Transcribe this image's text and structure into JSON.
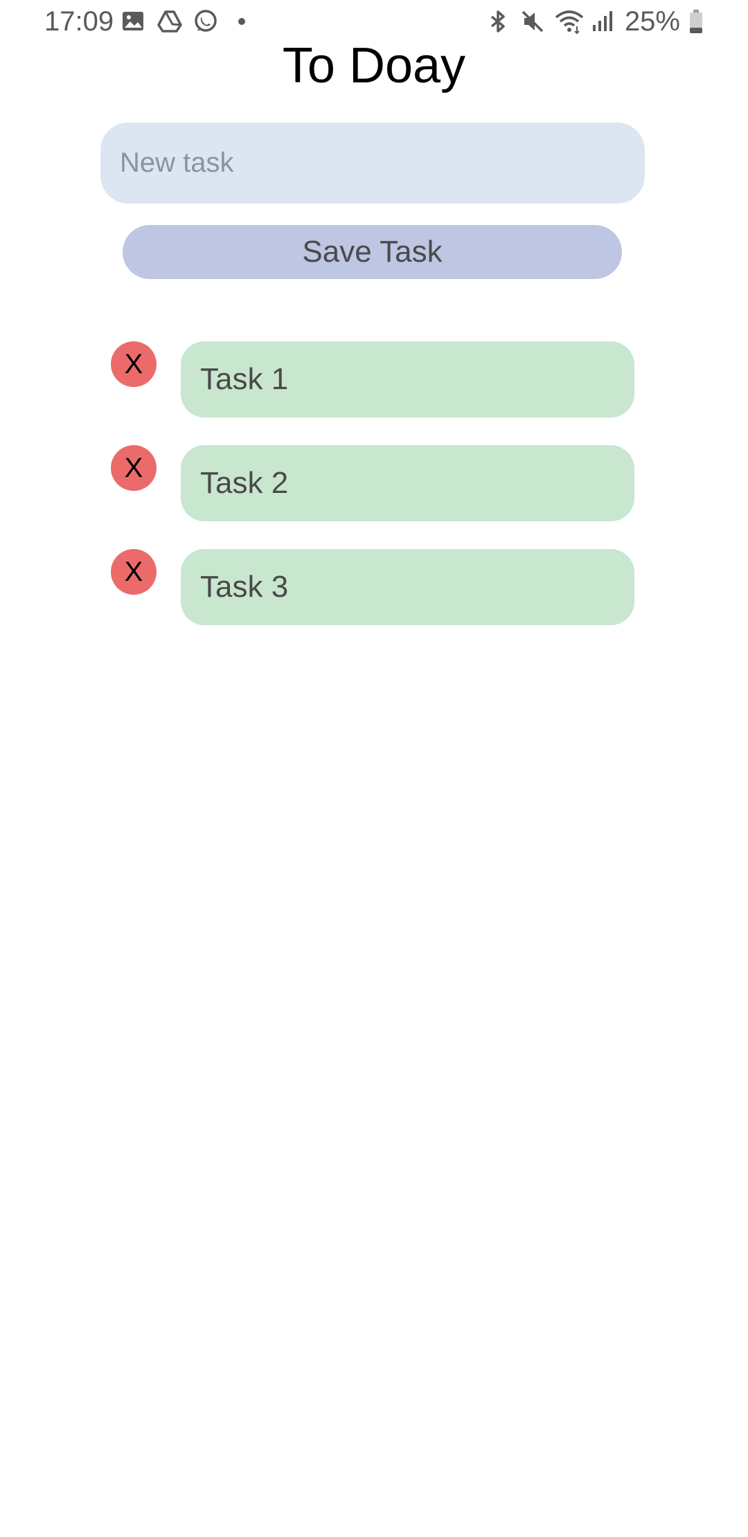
{
  "status_bar": {
    "time": "17:09",
    "left_icons": [
      "image-icon",
      "drive-icon",
      "whatsapp-icon",
      "dot-icon"
    ],
    "right_icons": [
      "bluetooth-icon",
      "mute-icon",
      "wifi-icon",
      "signal-icon"
    ],
    "battery_text": "25%",
    "battery_level": 0.25
  },
  "app": {
    "title": "To Doay"
  },
  "input": {
    "value": "",
    "placeholder": "New task"
  },
  "save_button": {
    "label": "Save Task"
  },
  "tasks": [
    {
      "delete_label": "X",
      "label": "Task 1"
    },
    {
      "delete_label": "X",
      "label": "Task 2"
    },
    {
      "delete_label": "X",
      "label": "Task 3"
    }
  ],
  "colors": {
    "input_background": "#dce6f2",
    "button_background": "#bec6e3",
    "delete_button": "#eb6b6b",
    "task_background": "#c9e7ce"
  }
}
